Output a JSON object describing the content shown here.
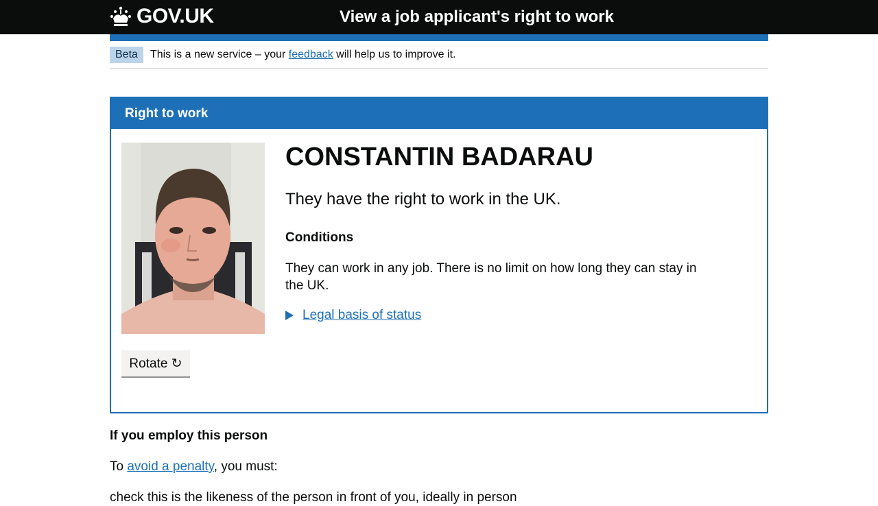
{
  "header": {
    "logo_text": "GOV.UK",
    "service_name": "View a job applicant's right to work"
  },
  "phase_banner": {
    "tag": "Beta",
    "text_before": "This is a new service – your ",
    "link": "feedback",
    "text_after": " will help us to improve it."
  },
  "panel": {
    "heading": "Right to work",
    "name": "CONSTANTIN BADARAU",
    "status": "They have the right to work in the UK.",
    "conditions_heading": "Conditions",
    "conditions_text": "They can work in any job. There is no limit on how long they can stay in the UK.",
    "legal_basis_link": "Legal basis of status",
    "rotate_label": "Rotate ↻"
  },
  "employ": {
    "heading": "If you employ this person",
    "text_before": "To ",
    "link": "avoid a penalty",
    "text_after": ", you must:",
    "partial_line": "check this is the likeness of the person in front of you, ideally in person"
  },
  "colors": {
    "header_bg": "#0b0c0c",
    "brand_blue": "#1d70b8",
    "phase_tag_bg": "#bbd4ea"
  }
}
